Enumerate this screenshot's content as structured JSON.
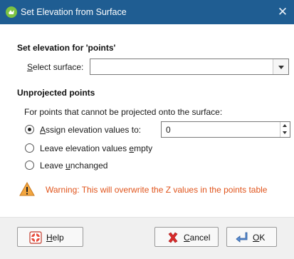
{
  "window": {
    "title": "Set Elevation from Surface",
    "app_icon": "app-logo-icon",
    "close_icon": "close-icon",
    "close_glyph": "✕"
  },
  "surface_section": {
    "title": "Set elevation for 'points'",
    "select_label_prefix": "S",
    "select_label_rest": "elect surface:",
    "select_value": ""
  },
  "unprojected_section": {
    "title": "Unprojected points",
    "description": "For points that cannot be projected onto the surface:",
    "options": [
      {
        "pre": "",
        "ul": "A",
        "post": "ssign elevation values to:",
        "checked": true
      },
      {
        "pre": "Leave elevation values ",
        "ul": "e",
        "post": "mpty",
        "checked": false
      },
      {
        "pre": "Leave ",
        "ul": "u",
        "post": "nchanged",
        "checked": false
      }
    ],
    "elevation_value": "0"
  },
  "warning": {
    "text": "Warning: This will overwrite the Z values in the points table",
    "color": "#e0541c"
  },
  "buttons": {
    "help": {
      "ul": "H",
      "rest": "elp",
      "icon": "lifebuoy-icon"
    },
    "cancel": {
      "ul": "C",
      "rest": "ancel",
      "icon": "red-x-icon"
    },
    "ok": {
      "ul": "O",
      "rest": "K",
      "icon": "enter-arrow-icon"
    }
  },
  "colors": {
    "titlebar": "#1f5d92",
    "footer": "#f0f0f0",
    "warning": "#e0541c"
  }
}
